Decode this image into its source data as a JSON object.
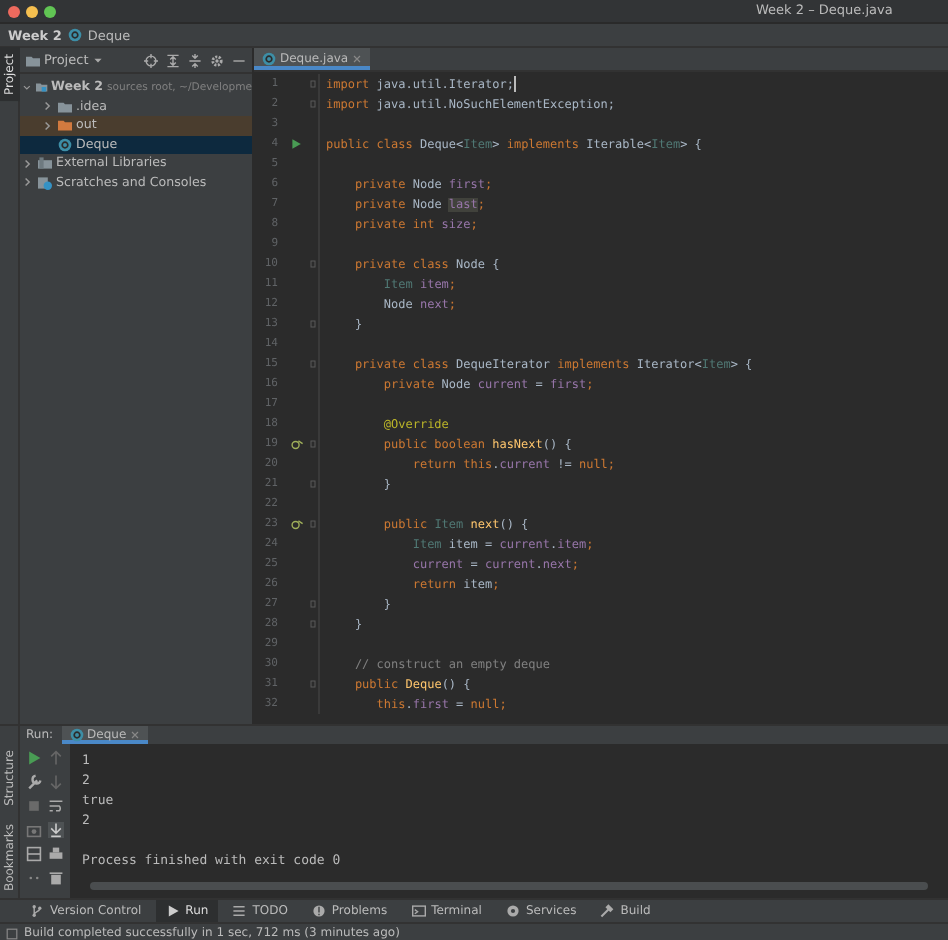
{
  "window": {
    "title": "Week 2 – Deque.java"
  },
  "breadcrumb": [
    "Week 2",
    "Deque"
  ],
  "side_stripe": {
    "top": [
      {
        "label": "Project",
        "selected": true
      }
    ],
    "bottom": [
      {
        "label": "Structure",
        "selected": false
      },
      {
        "label": "Bookmarks",
        "selected": false
      }
    ]
  },
  "project_panel": {
    "title": "Project",
    "tree": [
      {
        "label": "Week 2",
        "note": "sources root, ~/Developme",
        "kind": "module",
        "expanded": true,
        "selected": false,
        "children": [
          {
            "label": ".idea",
            "kind": "folder",
            "expanded": false,
            "selected": false
          },
          {
            "label": "out",
            "kind": "excluded",
            "expanded": false,
            "selected": false
          },
          {
            "label": "Deque",
            "kind": "class",
            "selected": true
          }
        ]
      },
      {
        "label": "External Libraries",
        "kind": "library",
        "expanded": false,
        "selected": false
      },
      {
        "label": "Scratches and Consoles",
        "kind": "scratch",
        "expanded": false,
        "selected": false
      }
    ]
  },
  "editor": {
    "tabs": [
      {
        "label": "Deque.java",
        "selected": true
      }
    ],
    "lines": [
      {
        "number": "1",
        "kind": "code",
        "fold": true,
        "caret": true,
        "tokens": [
          {
            "kind": "kw",
            "text": "import "
          },
          {
            "kind": "pl",
            "text": "java.util.Iterator;"
          }
        ]
      },
      {
        "number": "2",
        "kind": "code",
        "fold": true,
        "tokens": [
          {
            "kind": "kw",
            "text": "import "
          },
          {
            "kind": "pl",
            "text": "java.util.NoSuchElementException;"
          }
        ]
      },
      {
        "number": "3",
        "kind": "code",
        "fold": false
      },
      {
        "number": "4",
        "kind": "run",
        "fold": false,
        "tokens": [
          {
            "kind": "kw",
            "text": "public class "
          },
          {
            "kind": "pl",
            "text": "Deque<"
          },
          {
            "kind": "tp",
            "text": "Item"
          },
          {
            "kind": "pl",
            "text": "> "
          },
          {
            "kind": "kw",
            "text": "implements "
          },
          {
            "kind": "pl",
            "text": "Iterable<"
          },
          {
            "kind": "tp",
            "text": "Item"
          },
          {
            "kind": "pl",
            "text": "> {"
          }
        ]
      },
      {
        "number": "5",
        "kind": "code",
        "fold": false
      },
      {
        "number": "6",
        "kind": "code",
        "fold": false,
        "tokens": [
          {
            "kind": "kw",
            "text": "    private "
          },
          {
            "kind": "pl",
            "text": "Node "
          },
          {
            "kind": "fd",
            "text": "first"
          },
          {
            "kind": "kw",
            "text": ";"
          }
        ]
      },
      {
        "number": "7",
        "kind": "code",
        "fold": false,
        "tokens": [
          {
            "kind": "kw",
            "text": "    private "
          },
          {
            "kind": "pl",
            "text": "Node "
          },
          {
            "kind": "hl",
            "text": "last"
          },
          {
            "kind": "kw",
            "text": ";"
          }
        ]
      },
      {
        "number": "8",
        "kind": "code",
        "fold": false,
        "tokens": [
          {
            "kind": "kw",
            "text": "    private int "
          },
          {
            "kind": "fd",
            "text": "size"
          },
          {
            "kind": "kw",
            "text": ";"
          }
        ]
      },
      {
        "number": "9",
        "kind": "code",
        "fold": false
      },
      {
        "number": "10",
        "kind": "code",
        "fold": true,
        "tokens": [
          {
            "kind": "kw",
            "text": "    private class "
          },
          {
            "kind": "pl",
            "text": "Node {"
          }
        ]
      },
      {
        "number": "11",
        "kind": "code",
        "fold": false,
        "tokens": [
          {
            "kind": "tp",
            "text": "        Item "
          },
          {
            "kind": "fd",
            "text": "item"
          },
          {
            "kind": "kw",
            "text": ";"
          }
        ]
      },
      {
        "number": "12",
        "kind": "code",
        "fold": false,
        "tokens": [
          {
            "kind": "pl",
            "text": "        Node "
          },
          {
            "kind": "fd",
            "text": "next"
          },
          {
            "kind": "kw",
            "text": ";"
          }
        ]
      },
      {
        "number": "13",
        "kind": "code",
        "fold": true,
        "tokens": [
          {
            "kind": "pl",
            "text": "    }"
          }
        ]
      },
      {
        "number": "14",
        "kind": "code",
        "fold": false
      },
      {
        "number": "15",
        "kind": "code",
        "fold": true,
        "tokens": [
          {
            "kind": "kw",
            "text": "    private class "
          },
          {
            "kind": "pl",
            "text": "DequeIterator "
          },
          {
            "kind": "kw",
            "text": "implements "
          },
          {
            "kind": "pl",
            "text": "Iterator<"
          },
          {
            "kind": "tp",
            "text": "Item"
          },
          {
            "kind": "pl",
            "text": "> {"
          }
        ]
      },
      {
        "number": "16",
        "kind": "code",
        "fold": false,
        "tokens": [
          {
            "kind": "kw",
            "text": "        private "
          },
          {
            "kind": "pl",
            "text": "Node "
          },
          {
            "kind": "fd",
            "text": "current"
          },
          {
            "kind": "pl",
            "text": " = "
          },
          {
            "kind": "fd",
            "text": "first"
          },
          {
            "kind": "kw",
            "text": ";"
          }
        ]
      },
      {
        "number": "17",
        "kind": "code",
        "fold": false
      },
      {
        "number": "18",
        "kind": "code",
        "fold": false,
        "tokens": [
          {
            "kind": "an",
            "text": "        @Override"
          }
        ]
      },
      {
        "number": "19",
        "kind": "override",
        "fold": true,
        "tokens": [
          {
            "kind": "kw",
            "text": "        public boolean "
          },
          {
            "kind": "fn",
            "text": "hasNext"
          },
          {
            "kind": "pl",
            "text": "() {"
          }
        ]
      },
      {
        "number": "20",
        "kind": "code",
        "fold": false,
        "tokens": [
          {
            "kind": "kw",
            "text": "            return this"
          },
          {
            "kind": "pl",
            "text": "."
          },
          {
            "kind": "fd",
            "text": "current"
          },
          {
            "kind": "pl",
            "text": " != "
          },
          {
            "kind": "kw",
            "text": "null;"
          }
        ]
      },
      {
        "number": "21",
        "kind": "code",
        "fold": true,
        "tokens": [
          {
            "kind": "pl",
            "text": "        }"
          }
        ]
      },
      {
        "number": "22",
        "kind": "code",
        "fold": false
      },
      {
        "number": "23",
        "kind": "override",
        "fold": true,
        "tokens": [
          {
            "kind": "kw",
            "text": "        public "
          },
          {
            "kind": "tp",
            "text": "Item "
          },
          {
            "kind": "fn",
            "text": "next"
          },
          {
            "kind": "pl",
            "text": "() {"
          }
        ]
      },
      {
        "number": "24",
        "kind": "code",
        "fold": false,
        "tokens": [
          {
            "kind": "tp",
            "text": "            Item "
          },
          {
            "kind": "pl",
            "text": "item = "
          },
          {
            "kind": "fd",
            "text": "current"
          },
          {
            "kind": "pl",
            "text": "."
          },
          {
            "kind": "fd",
            "text": "item"
          },
          {
            "kind": "kw",
            "text": ";"
          }
        ]
      },
      {
        "number": "25",
        "kind": "code",
        "fold": false,
        "tokens": [
          {
            "kind": "fd",
            "text": "            current"
          },
          {
            "kind": "pl",
            "text": " = "
          },
          {
            "kind": "fd",
            "text": "current"
          },
          {
            "kind": "pl",
            "text": "."
          },
          {
            "kind": "fd",
            "text": "next"
          },
          {
            "kind": "kw",
            "text": ";"
          }
        ]
      },
      {
        "number": "26",
        "kind": "code",
        "fold": false,
        "tokens": [
          {
            "kind": "kw",
            "text": "            return "
          },
          {
            "kind": "pl",
            "text": "item"
          },
          {
            "kind": "kw",
            "text": ";"
          }
        ]
      },
      {
        "number": "27",
        "kind": "code",
        "fold": true,
        "tokens": [
          {
            "kind": "pl",
            "text": "        }"
          }
        ]
      },
      {
        "number": "28",
        "kind": "code",
        "fold": true,
        "tokens": [
          {
            "kind": "pl",
            "text": "    }"
          }
        ]
      },
      {
        "number": "29",
        "kind": "code",
        "fold": false
      },
      {
        "number": "30",
        "kind": "code",
        "fold": false,
        "tokens": [
          {
            "kind": "cm",
            "text": "    // construct an empty deque"
          }
        ]
      },
      {
        "number": "31",
        "kind": "code",
        "fold": true,
        "tokens": [
          {
            "kind": "kw",
            "text": "    public "
          },
          {
            "kind": "fn",
            "text": "Deque"
          },
          {
            "kind": "pl",
            "text": "() {"
          }
        ]
      },
      {
        "number": "32",
        "kind": "code",
        "fold": false,
        "tokens": [
          {
            "kind": "kw",
            "text": "       this"
          },
          {
            "kind": "pl",
            "text": "."
          },
          {
            "kind": "fd",
            "text": "first"
          },
          {
            "kind": "pl",
            "text": " = "
          },
          {
            "kind": "kw",
            "text": "null;"
          }
        ]
      }
    ]
  },
  "run_panel": {
    "label": "Run:",
    "tabs": [
      {
        "label": "Deque",
        "selected": true
      }
    ],
    "output": [
      "1",
      "2",
      "true",
      "2"
    ],
    "exit_message": "Process finished with exit code 0"
  },
  "tool_tabs": [
    {
      "label": "Version Control",
      "selected": false
    },
    {
      "label": "Run",
      "selected": true
    },
    {
      "label": "TODO",
      "selected": false
    },
    {
      "label": "Problems",
      "selected": false
    },
    {
      "label": "Terminal",
      "selected": false
    },
    {
      "label": "Services",
      "selected": false
    },
    {
      "label": "Build",
      "selected": false
    }
  ],
  "status_bar": {
    "message": "Build completed successfully in 1 sec, 712 ms (3 minutes ago)"
  }
}
